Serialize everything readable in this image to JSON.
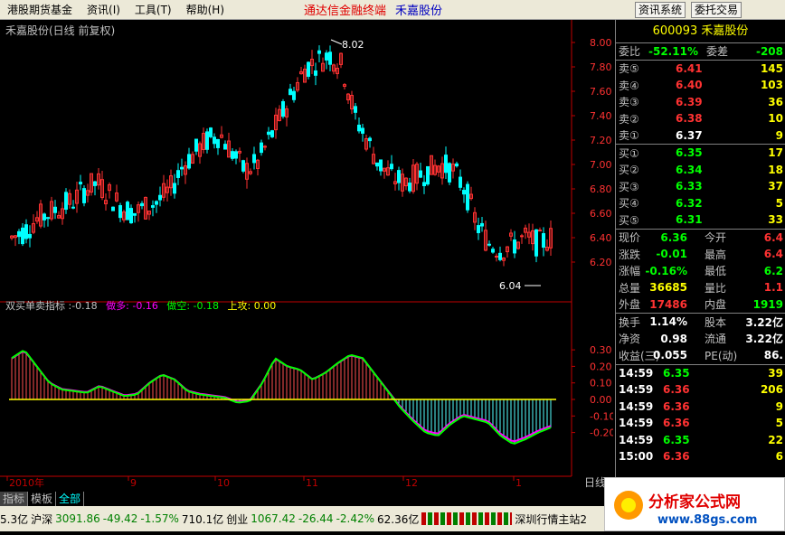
{
  "menu": {
    "items": [
      "港股期货基金",
      "资讯(I)",
      "工具(T)",
      "帮助(H)"
    ],
    "brand": "通达信金融终端",
    "stock_name": "禾嘉股份",
    "btn_info": "资讯系统",
    "btn_trade": "委托交易"
  },
  "chart": {
    "title": "禾嘉股份(日线 前复权)",
    "high_label": "8.02",
    "low_label": "6.04",
    "period_label": "日线",
    "price_ticks": [
      "8.00",
      "7.80",
      "7.60",
      "7.40",
      "7.20",
      "7.00",
      "6.80",
      "6.60",
      "6.40",
      "6.20"
    ],
    "ind_ticks": [
      "0.30",
      "0.20",
      "0.10",
      "0.00",
      "-0.10",
      "-0.20"
    ],
    "x_labels": [
      "2010年",
      "9",
      "10",
      "11",
      "12",
      "1"
    ]
  },
  "indicator": {
    "name": "双买单卖指标",
    "value": ":-0.18",
    "zuoduo": "做多: -0.16",
    "zuokong": "做空: -0.18",
    "shanggong": "上攻: 0.00"
  },
  "colors": {
    "up": "#ff3232",
    "down": "#00ffff",
    "bar_up": "#ff5050",
    "bar_down": "#54ffff",
    "line_green": "#00ff00",
    "line_magenta": "#ff00ff",
    "zero": "#ffff00"
  },
  "quote": {
    "code_name": "600093 禾嘉股份",
    "weibi_label": "委比",
    "weibi": "-52.11%",
    "weicha_label": "委差",
    "weicha": "-208",
    "asks": [
      {
        "l": "卖⑤",
        "p": "6.41",
        "v": "145"
      },
      {
        "l": "卖④",
        "p": "6.40",
        "v": "103"
      },
      {
        "l": "卖③",
        "p": "6.39",
        "v": "36"
      },
      {
        "l": "卖②",
        "p": "6.38",
        "v": "10"
      },
      {
        "l": "卖①",
        "p": "6.37",
        "v": "9"
      }
    ],
    "bids": [
      {
        "l": "买①",
        "p": "6.35",
        "v": "17"
      },
      {
        "l": "买②",
        "p": "6.34",
        "v": "18"
      },
      {
        "l": "买③",
        "p": "6.33",
        "v": "37"
      },
      {
        "l": "买④",
        "p": "6.32",
        "v": "5"
      },
      {
        "l": "买⑤",
        "p": "6.31",
        "v": "33"
      }
    ],
    "stats": [
      {
        "l1": "现价",
        "v1": "6.36",
        "l2": "今开",
        "v2": "6.4"
      },
      {
        "l1": "涨跌",
        "v1": "-0.01",
        "l2": "最高",
        "v2": "6.4"
      },
      {
        "l1": "涨幅",
        "v1": "-0.16%",
        "l2": "最低",
        "v2": "6.2"
      },
      {
        "l1": "总量",
        "v1": "36685",
        "l2": "量比",
        "v2": "1.1"
      },
      {
        "l1": "外盘",
        "v1": "17486",
        "l2": "内盘",
        "v2": "1919"
      }
    ],
    "stats2": [
      {
        "l1": "换手",
        "v1": "1.14%",
        "l2": "股本",
        "v2": "3.22亿"
      },
      {
        "l1": "净资",
        "v1": "0.98",
        "l2": "流通",
        "v2": "3.22亿"
      },
      {
        "l1": "收益(三)",
        "v1": "0.055",
        "l2": "PE(动)",
        "v2": "86."
      }
    ],
    "ticks": [
      {
        "t": "14:59",
        "p": "6.35",
        "v": "39"
      },
      {
        "t": "14:59",
        "p": "6.36",
        "v": "206"
      },
      {
        "t": "14:59",
        "p": "6.36",
        "v": "9"
      },
      {
        "t": "14:59",
        "p": "6.36",
        "v": "5"
      },
      {
        "t": "14:59",
        "p": "6.35",
        "v": "22"
      },
      {
        "t": "15:00",
        "p": "6.36",
        "v": "6"
      }
    ]
  },
  "tabs": [
    "指标",
    "模板",
    "全部"
  ],
  "status": {
    "s0": "5.3亿",
    "s1": "沪深",
    "s2": "3091.86",
    "s3": "-49.42",
    "s4": "-1.57%",
    "s5": "710.1亿",
    "s6": "创业",
    "s7": "1067.42",
    "s8": "-26.44",
    "s9": "-2.42%",
    "s10": "62.36亿",
    "s11": "深圳行情主站2"
  },
  "logo": {
    "title": "分析家公式网",
    "url": "www.88gs.com"
  }
}
